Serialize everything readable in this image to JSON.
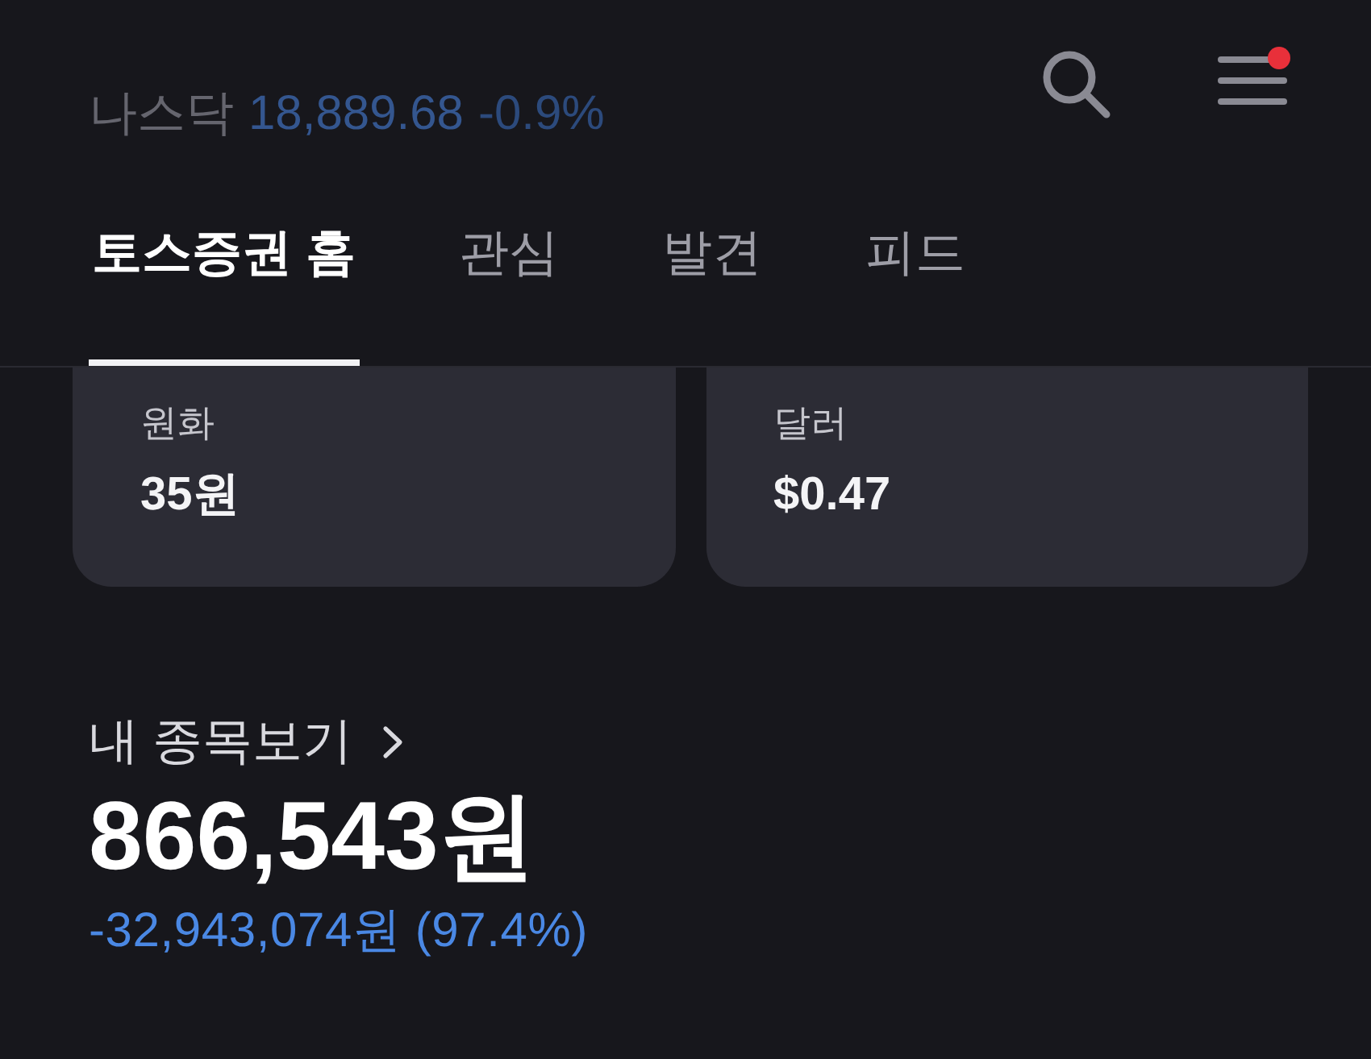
{
  "header": {
    "ticker": {
      "name": "나스닥",
      "value": "18,889.68",
      "change": "-0.9%"
    },
    "menu_notification": true
  },
  "tabs": [
    {
      "label": "토스증권 홈",
      "selected": true
    },
    {
      "label": "관심",
      "selected": false
    },
    {
      "label": "발견",
      "selected": false
    },
    {
      "label": "피드",
      "selected": false
    }
  ],
  "balances": [
    {
      "label": "원화",
      "value": "35원"
    },
    {
      "label": "달러",
      "value": "$0.47"
    }
  ],
  "portfolio": {
    "link": "내 종목보기",
    "total": "866,543원",
    "change": "-32,943,074원 (97.4%)"
  }
}
